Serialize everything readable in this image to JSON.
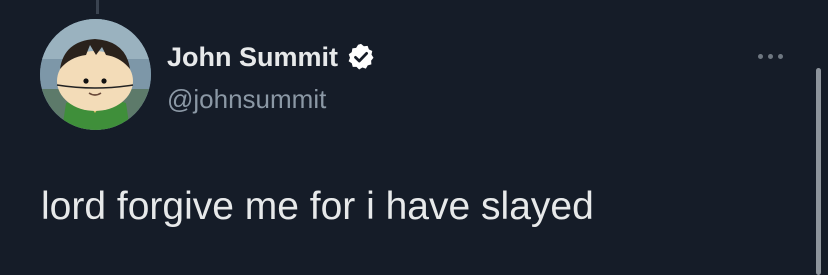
{
  "tweet": {
    "author": {
      "display_name": "John Summit",
      "handle": "@johnsummit",
      "verified": true,
      "avatar_icon": "cartoon-character-avatar"
    },
    "text": "lord forgive me for i have slayed",
    "more_icon": "more-horizontal-icon"
  },
  "colors": {
    "background": "#151c28",
    "primary_text": "#e7e9ea",
    "secondary_text": "#8b98a5",
    "verified_badge": "#ffffff"
  }
}
